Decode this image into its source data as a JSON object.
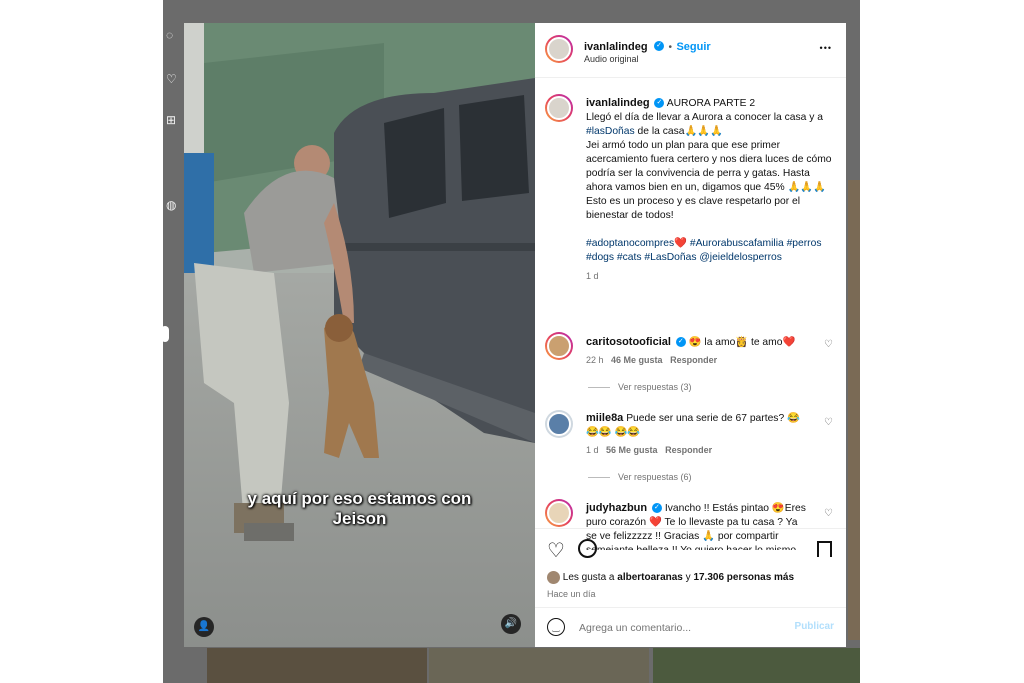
{
  "post": {
    "author": "ivanlalindeg",
    "follow_label": "Seguir",
    "audio": "Audio original",
    "more_label": "•••"
  },
  "video": {
    "subtitle_line1": "y aquí por eso estamos con",
    "subtitle_line2": "Jeison"
  },
  "caption": {
    "author": "ivanlalindeg",
    "title": "AURORA PARTE 2",
    "line1": "Llegó el día de llevar a Aurora a conocer la casa y a",
    "hashtag1": "#lasDoñas",
    "line1b": "de la casa🙏🙏🙏",
    "line2": "Jei armó todo un plan para que ese primer acercamiento fuera certero y nos diera luces de cómo podría ser la convivencia de perra y gatas. Hasta ahora vamos bien en un, digamos que 45% 🙏🙏🙏",
    "line3": "Esto es un proceso y es clave respetarlo por el bienestar de todos!",
    "tags_line1": "#adoptanocompres❤️ #Aurorabuscafamilia #perros",
    "tags_line2": "#dogs #cats #LasDoñas @jeieldelosperros",
    "age": "1 d"
  },
  "comments": [
    {
      "user": "caritosotooficial",
      "text": "😍 la amo👸 te amo❤️",
      "age": "22 h",
      "likes": "46 Me gusta",
      "reply": "Responder",
      "view_replies": "Ver respuestas (3)"
    },
    {
      "user": "miile8a",
      "text": "Puede ser una serie de 67 partes? 😂😂😂 😂😂",
      "age": "1 d",
      "likes": "56 Me gusta",
      "reply": "Responder",
      "view_replies": "Ver respuestas (6)"
    },
    {
      "user": "judyhazbun",
      "text": "Ivancho !! Estás pintao 😍Eres puro corazón ❤️ Te lo llevaste pa tu casa ? Ya se ve felizzzzz !! Gracias 🙏 por compartir semejante belleza !! Yo quiero hacer lo mismo"
    }
  ],
  "likes_summary": {
    "prefix": "Les gusta a",
    "user": "albertoaranas",
    "middle": "y",
    "count": "17.306 personas más",
    "time": "Hace un día"
  },
  "add_comment": {
    "placeholder": "Agrega un comentario...",
    "publish": "Publicar"
  },
  "colors": {
    "accent": "#0095f6",
    "hashtag": "#00376b",
    "like_red": "#ed4956"
  }
}
